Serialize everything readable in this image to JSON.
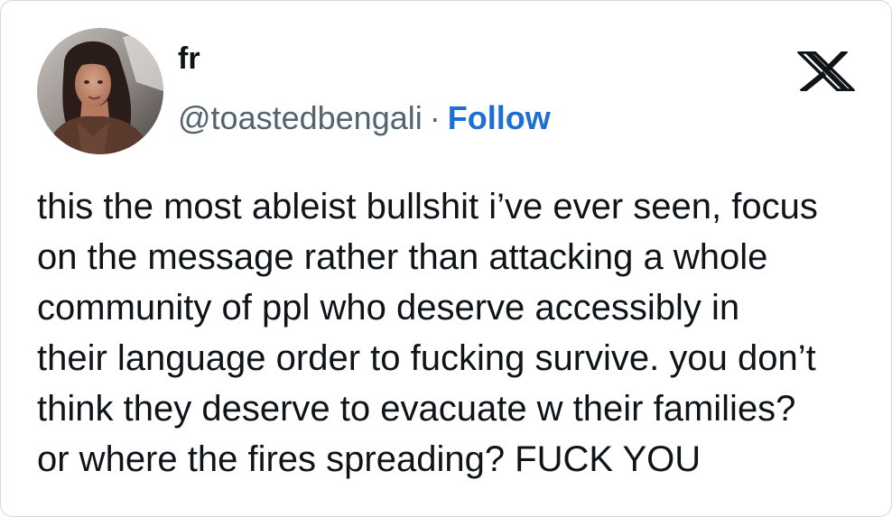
{
  "tweet": {
    "author": {
      "display_name": "fr",
      "handle": "@toastedbengali",
      "separator": "·",
      "follow_label": "Follow",
      "avatar_icon": "profile-photo"
    },
    "platform_icon": "x-logo-icon",
    "body_lines": [
      "this the most ableist bullshit i’ve ever seen, focus",
      "on the message rather than attacking a whole",
      "community of ppl who deserve accessibly in",
      "their language order to fucking survive. you don’t",
      "think they deserve to evacuate w their families?",
      "or where the fires spreading? FUCK YOU"
    ]
  },
  "colors": {
    "text": "#0f1419",
    "secondary_text": "#536471",
    "follow_link": "#1d6fd6",
    "background": "#ffffff",
    "border": "#cfd9de"
  }
}
